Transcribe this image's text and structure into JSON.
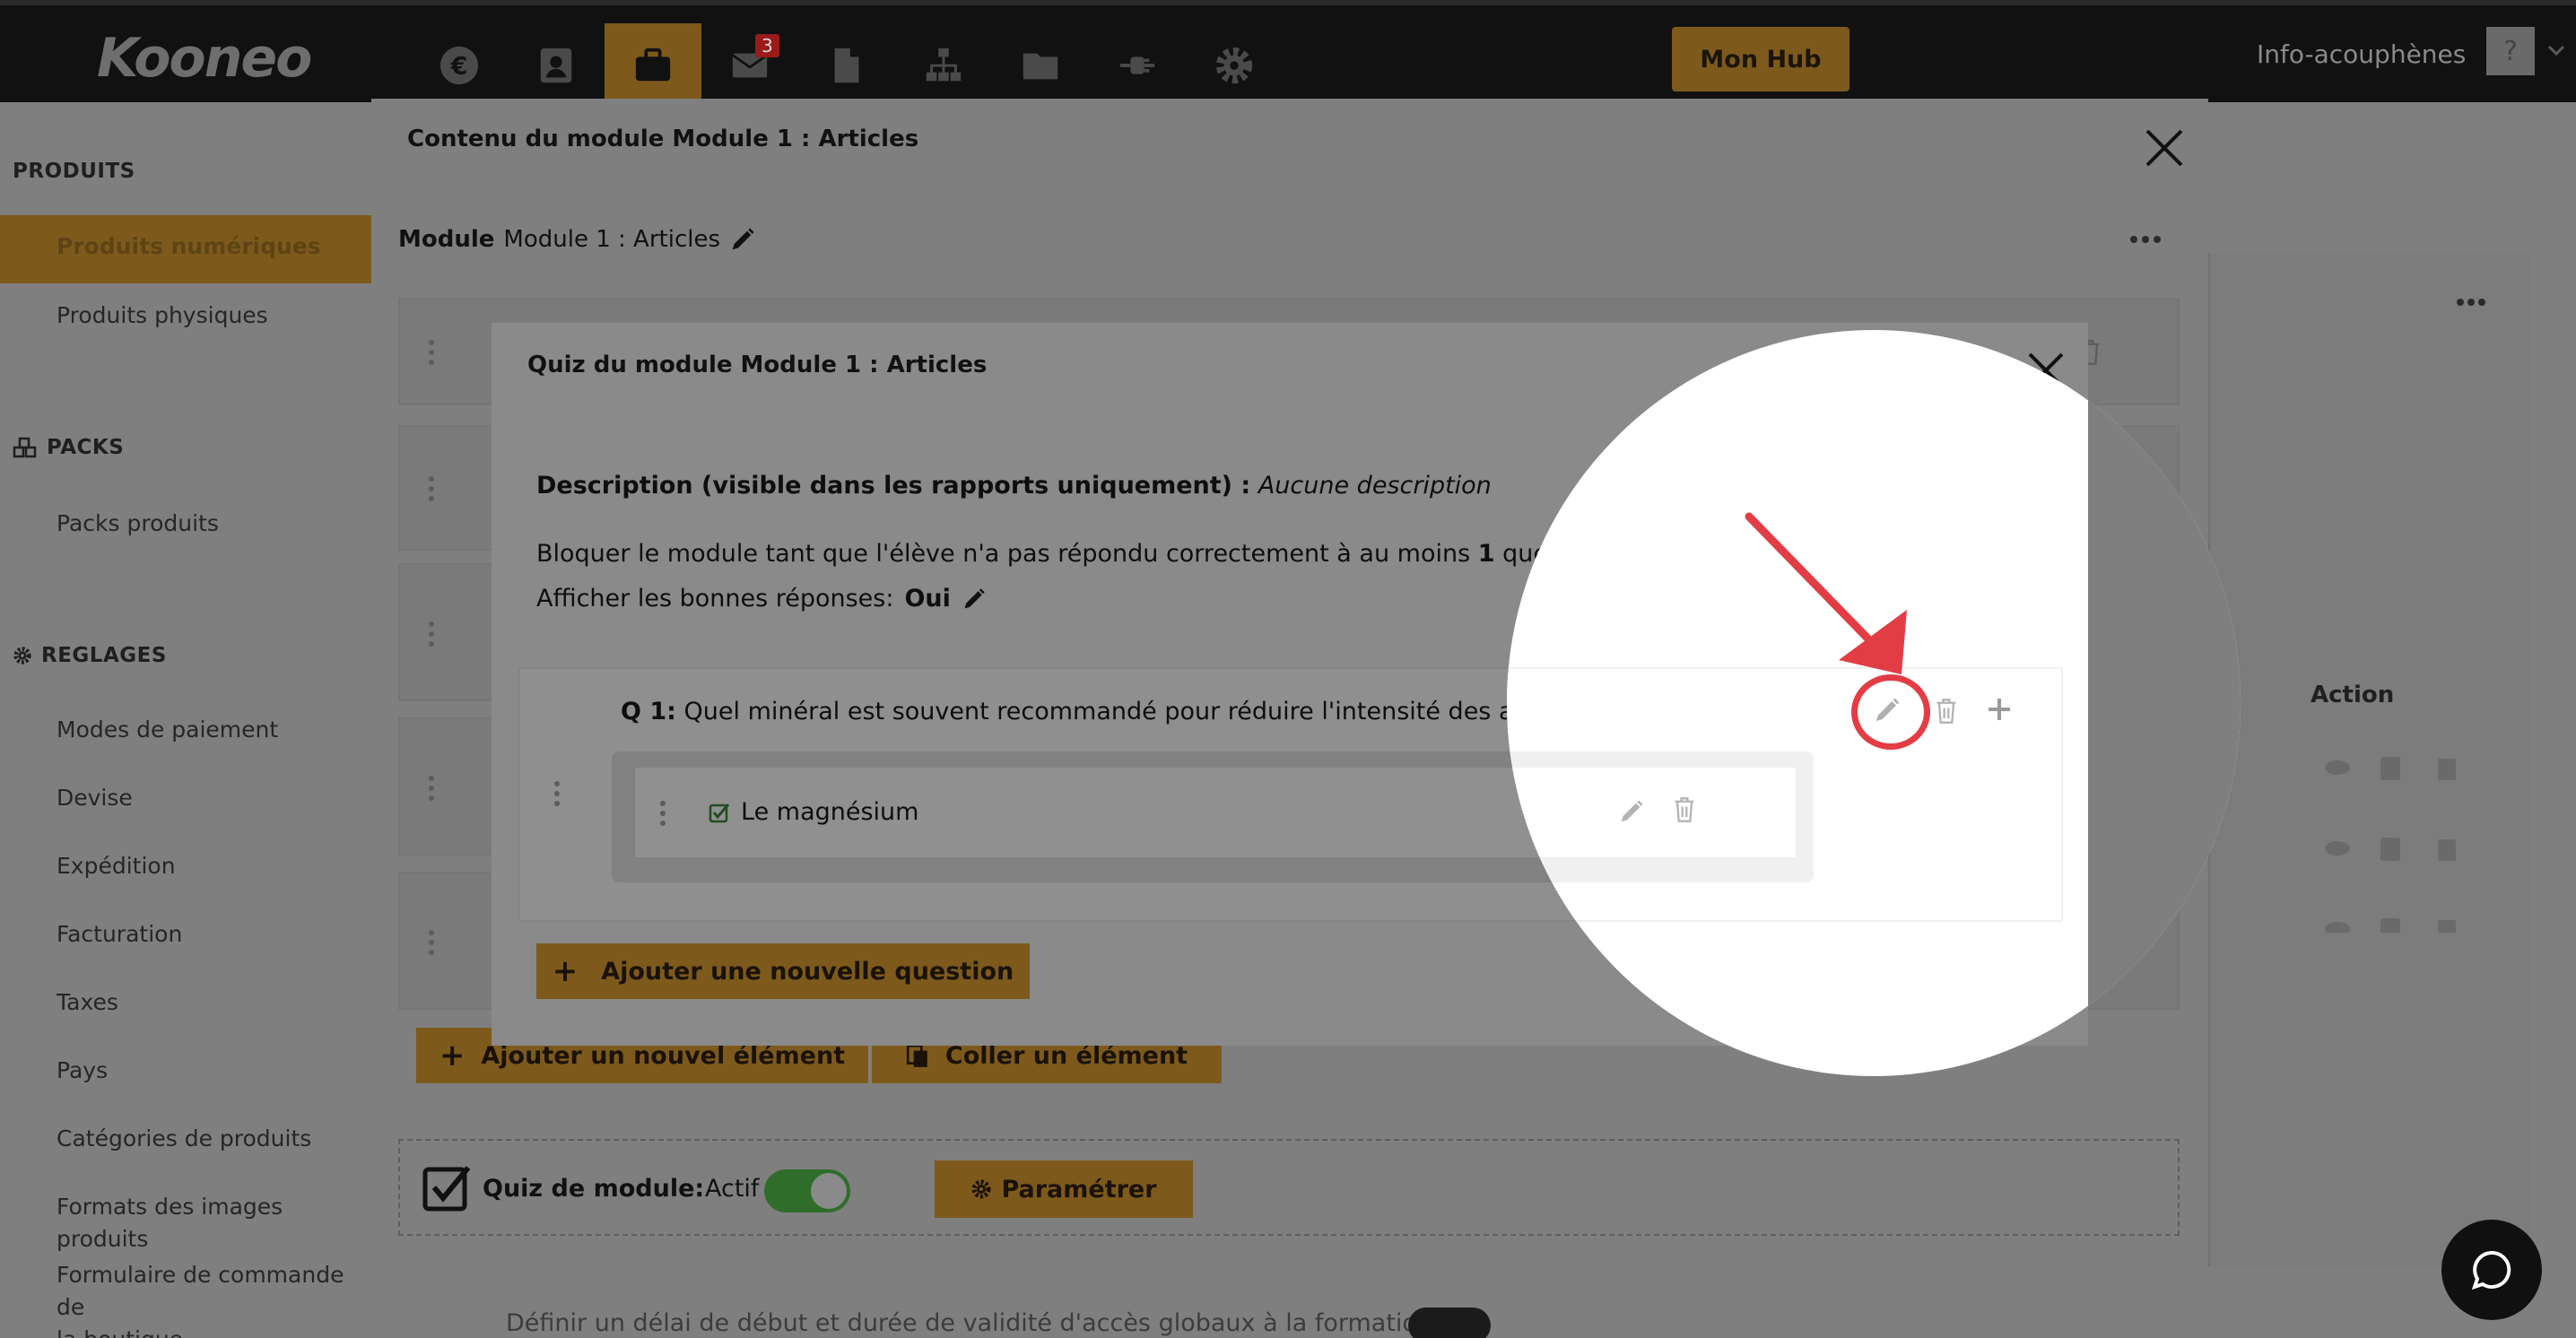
{
  "topbar": {
    "logo": "Kooneo",
    "nav_icons": [
      "euro-icon",
      "contacts-icon",
      "products-icon",
      "mail-icon",
      "document-icon",
      "sitemap-icon",
      "folder-icon",
      "plug-icon",
      "gear-icon"
    ],
    "mail_badge": "3",
    "hub_button": "Mon Hub",
    "user_name": "Info-acouphènes",
    "avatar_glyph": "?"
  },
  "sidebar": {
    "produits_title": "PRODUITS",
    "produits_items": [
      "Produits numériques",
      "Produits physiques"
    ],
    "packs_title": "PACKS",
    "packs_items": [
      "Packs produits"
    ],
    "reglages_title": "REGLAGES",
    "reglages_items": [
      "Modes de paiement",
      "Devise",
      "Expédition",
      "Facturation",
      "Taxes",
      "Pays",
      "Catégories de produits",
      "Formats des images produits"
    ],
    "formulaire_line1": "Formulaire de commande de",
    "formulaire_line2": "la boutique"
  },
  "background": {
    "action_header": "Action",
    "bottom_text": "Définir un délai de début et durée de validité d'accès globaux à la formation"
  },
  "outer_modal": {
    "title": "Contenu du module Module 1 : Articles",
    "module_label": "Module",
    "module_name": "Module 1 : Articles",
    "add_element": "Ajouter un nouvel élément",
    "paste_element": "Coller un élément",
    "quiz_label": "Quiz de module:",
    "actif_label": "Actif",
    "param_button": "Paramétrer"
  },
  "quiz_modal": {
    "title": "Quiz du module Module 1 : Articles",
    "description_label": "Description (visible dans les rapports uniquement) :",
    "description_value": "Aucune description",
    "block_text_before": "Bloquer le module tant que l'élève n'a pas répondu correctement à au moins",
    "block_count": "1",
    "block_text_after": "questions",
    "show_answers_label": "Afficher les bonnes réponses:",
    "show_answers_value": "Oui",
    "question_label": "Q 1:",
    "question_text": "Quel minéral est souvent recommandé pour réduire l'intensité des acouphènes ?",
    "answer_text": "Le magnésium",
    "add_question": "Ajouter une nouvelle question"
  },
  "colors": {
    "accent_dim": "#7d5a1c",
    "highlight": "#e23d45",
    "toggle_on": "#2f6d2b"
  }
}
